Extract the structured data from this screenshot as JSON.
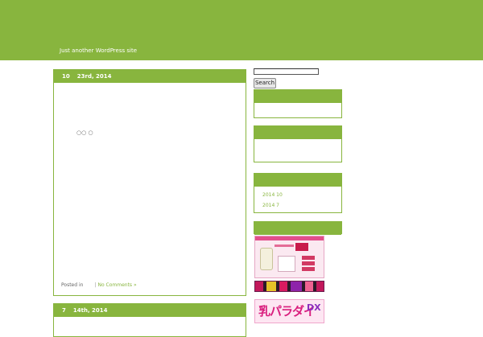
{
  "site": {
    "tagline": "Just another WordPress site",
    "accent_color": "#88b53e"
  },
  "posts": [
    {
      "date_month": "10",
      "date_day": "23rd, 2014",
      "body_text": "○○  ○",
      "meta_posted_in": "Posted in",
      "meta_separator": "|",
      "meta_comments": "No Comments »"
    },
    {
      "date_month": "7",
      "date_day": "14th, 2014"
    }
  ],
  "sidebar": {
    "search": {
      "value": "",
      "button_label": "Search"
    },
    "archives": [
      "2014 10",
      "2014 7"
    ]
  },
  "ads": {
    "banner_3_text": "乳パラダイス",
    "banner_3_suffix": "DX"
  }
}
